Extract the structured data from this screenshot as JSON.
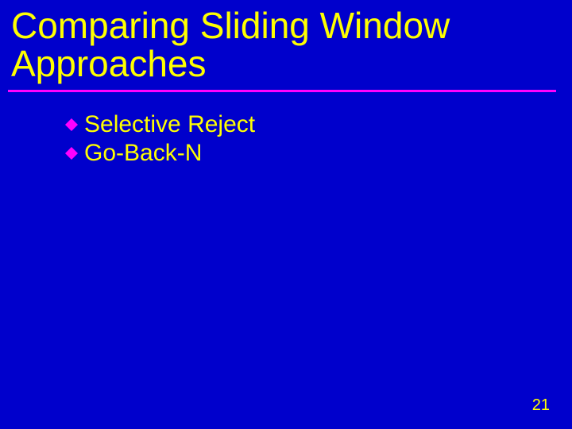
{
  "title": "Comparing Sliding Window Approaches",
  "bullets": {
    "items": [
      {
        "label": "Selective Reject"
      },
      {
        "label": "Go-Back-N"
      }
    ]
  },
  "page_number": "21"
}
